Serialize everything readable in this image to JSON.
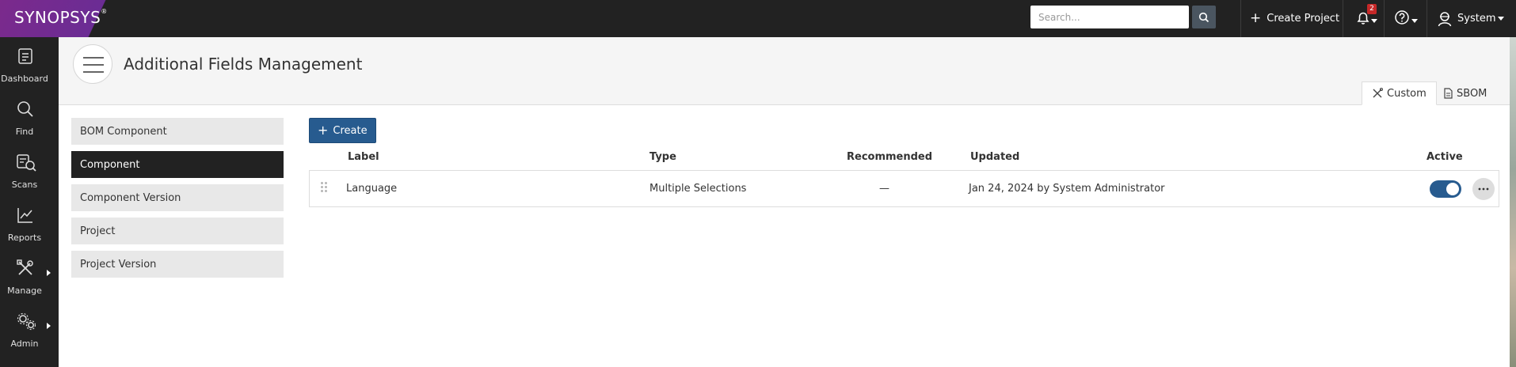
{
  "brand": {
    "logo": "SYNOPSYS",
    "logo_mark": "®"
  },
  "topbar": {
    "search_placeholder": "Search...",
    "create_project": "Create Project",
    "notification_count": "2",
    "user": "System"
  },
  "leftnav": {
    "items": [
      {
        "label": "Dashboard",
        "icon": "dashboard-icon"
      },
      {
        "label": "Find",
        "icon": "search-icon"
      },
      {
        "label": "Scans",
        "icon": "scans-icon"
      },
      {
        "label": "Reports",
        "icon": "chart-icon"
      },
      {
        "label": "Manage",
        "icon": "tools-icon",
        "has_submenu": true
      },
      {
        "label": "Admin",
        "icon": "gears-icon",
        "has_submenu": true
      }
    ]
  },
  "header": {
    "title": "Additional Fields Management",
    "tabs": [
      {
        "label": "Custom",
        "active": true
      },
      {
        "label": "SBOM",
        "active": false
      }
    ]
  },
  "categories": [
    {
      "label": "BOM Component",
      "active": false
    },
    {
      "label": "Component",
      "active": true
    },
    {
      "label": "Component Version",
      "active": false
    },
    {
      "label": "Project",
      "active": false
    },
    {
      "label": "Project Version",
      "active": false
    }
  ],
  "actions": {
    "create": "Create"
  },
  "table": {
    "headers": {
      "label": "Label",
      "type": "Type",
      "recommended": "Recommended",
      "updated": "Updated",
      "active": "Active"
    },
    "rows": [
      {
        "label": "Language",
        "type": "Multiple Selections",
        "recommended": "—",
        "updated": "Jan 24, 2024 by System Administrator",
        "active": true
      }
    ]
  },
  "colors": {
    "topbar": "#222222",
    "brand_purple": "#6b2c94",
    "accent_blue": "#275b8f",
    "active_category": "#222222"
  }
}
